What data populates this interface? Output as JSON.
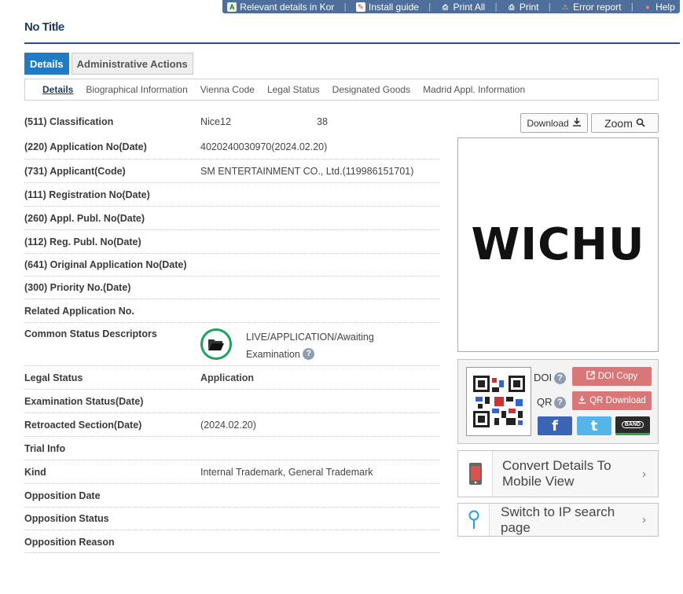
{
  "topbar": {
    "items": [
      {
        "label": "Relevant details in Kor",
        "icon": "translate-icon"
      },
      {
        "label": "Install guide",
        "icon": "pdf-icon"
      },
      {
        "label": "Print All",
        "icon": "printer-icon"
      },
      {
        "label": "Print",
        "icon": "printer-icon"
      },
      {
        "label": "Error report",
        "icon": "warning-icon"
      },
      {
        "label": "Help",
        "icon": "help-person-icon"
      }
    ]
  },
  "page": {
    "title": "No Title"
  },
  "main_tabs": [
    {
      "label": "Details",
      "active": true
    },
    {
      "label": "Administrative Actions",
      "active": false
    }
  ],
  "sub_tabs": [
    {
      "label": "Details",
      "active": true
    },
    {
      "label": "Biographical Information"
    },
    {
      "label": "Vienna Code"
    },
    {
      "label": "Legal Status"
    },
    {
      "label": "Designated Goods"
    },
    {
      "label": "Madrid Appl. Information"
    }
  ],
  "details": {
    "classification": {
      "label": "(511) Classification",
      "value": "Nice12",
      "value2": "38"
    },
    "application_no": {
      "label": "(220) Application No(Date)",
      "value": "4020240030970(2024.02.20)"
    },
    "applicant": {
      "label": "(731) Applicant(Code)",
      "value": "SM ENTERTAINMENT CO., Ltd.(119986151701)"
    },
    "registration_no": {
      "label": "(111) Registration No(Date)",
      "value": ""
    },
    "appl_publ_no": {
      "label": "(260) Appl. Publ. No(Date)",
      "value": ""
    },
    "reg_publ_no": {
      "label": "(112) Reg. Publ. No(Date)",
      "value": ""
    },
    "original_application_no": {
      "label": "(641) Original Application No(Date)",
      "value": ""
    },
    "priority_no": {
      "label": "(300) Priority No.(Date)",
      "value": ""
    },
    "related_application_no": {
      "label": "Related Application No.",
      "value": ""
    },
    "common_status": {
      "label": "Common Status Descriptors",
      "line1": "LIVE/APPLICATION/Awaiting",
      "line2": "Examination",
      "help": "?"
    },
    "legal_status": {
      "label": "Legal Status",
      "value": "Application"
    },
    "examination_status": {
      "label": "Examination Status(Date)",
      "value": ""
    },
    "retroacted_section": {
      "label": "Retroacted Section(Date)",
      "value": "(2024.02.20)"
    },
    "trial_info": {
      "label": "Trial Info",
      "value": ""
    },
    "kind": {
      "label": "Kind",
      "value": "Internal Trademark, General Trademark"
    },
    "opposition_date": {
      "label": "Opposition Date",
      "value": ""
    },
    "opposition_status": {
      "label": "Opposition Status",
      "value": ""
    },
    "opposition_reason": {
      "label": "Opposition Reason",
      "value": ""
    }
  },
  "image_panel": {
    "download_label": "Download",
    "zoom_label": "Zoom",
    "mark_text": "WICHU"
  },
  "share_panel": {
    "doi_label": "DOI",
    "qr_label": "QR",
    "help": "?",
    "doi_copy_label": "DOI Copy",
    "qr_download_label": "QR Download",
    "facebook": "f",
    "twitter": "t",
    "band": "BAND"
  },
  "links": {
    "mobile_view": {
      "line1": "Convert Details To",
      "line2": "Mobile View"
    },
    "ip_search": {
      "label": "Switch to IP search page"
    }
  },
  "colors": {
    "topbar": "#4e6f9b",
    "active_tab": "#1f7bc4",
    "status_green": "#1ea25c",
    "qr_button": "#d87777",
    "facebook": "#3b64b5",
    "twitter": "#55b4e8",
    "band": "#2b2b2b"
  }
}
